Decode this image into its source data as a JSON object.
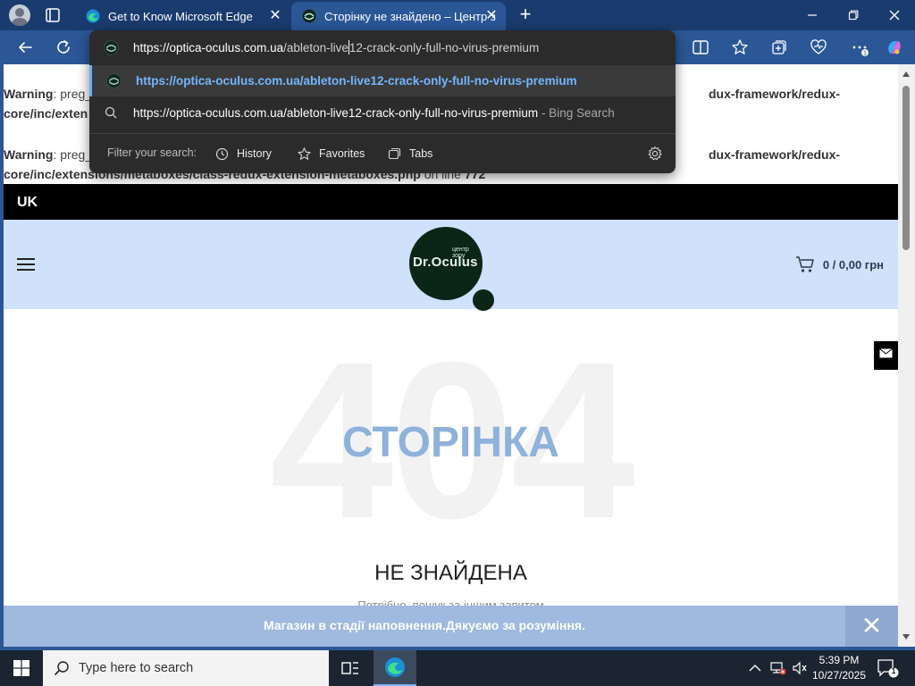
{
  "browser": {
    "tabs": [
      {
        "title": "Get to Know Microsoft Edge",
        "close": "✕"
      },
      {
        "title": "Сторінку не знайдено – Центр з",
        "close": "✕"
      }
    ],
    "new_tab": "+",
    "window_controls": {
      "minimize": "—",
      "maximize": "❐",
      "close": "✕"
    },
    "colors": {
      "titlebar": "#1a3b6e",
      "toolbar": "#2b5797",
      "suggest_highlight": "#74b6ff"
    }
  },
  "omnibox": {
    "input_host": "https://optica-oculus.com.ua",
    "input_path_before_caret": "/ableton-live",
    "input_path_after_caret": "12-crack-only-full-no-virus-premium",
    "suggestions": [
      {
        "text": "https://optica-oculus.com.ua/ableton-live12-crack-only-full-no-virus-premium",
        "icon": "site-favicon"
      },
      {
        "text": "https://optica-oculus.com.ua/ableton-live12-crack-only-full-no-virus-premium",
        "sub": " - Bing Search",
        "icon": "search-icon"
      }
    ],
    "filter_label": "Filter your search:",
    "filters": [
      "History",
      "Favorites",
      "Tabs"
    ]
  },
  "page": {
    "warnings": [
      {
        "label": "Warning",
        "pre": ": preg_",
        "pre2": "core/inc/exten",
        "tail1": "dux-framework/redux-",
        "tail2": ""
      },
      {
        "label": "Warning",
        "pre": ": preg_",
        "line2": "core/inc/extensions/metaboxes/class-redux-extension-metaboxes.php",
        "on_line": " on line ",
        "line_no": "772",
        "tail1": "dux-framework/redux-"
      }
    ],
    "lang": "UK",
    "logo": {
      "small": "центр зору",
      "main": "Dr.Oculus"
    },
    "cart": "0 / 0,00 грн",
    "big_code": "404",
    "title": "СТОРІНКА",
    "subtitle": "НЕ ЗНАЙДЕНА",
    "hint": "Потрібно, пошук за іншим запитом",
    "notice": "Магазин в стадії наповнення.Дякуємо за розуміння.",
    "notice_close": "✕",
    "colors": {
      "header_bg": "#cfe1fb",
      "title": "#8fb2db",
      "notice_bg": "#9fb9df",
      "logo": "#0a2617"
    }
  },
  "taskbar": {
    "search_placeholder": "Type here to search",
    "time": "5:39 PM",
    "date": "10/27/2025",
    "notifications_count": "1"
  }
}
